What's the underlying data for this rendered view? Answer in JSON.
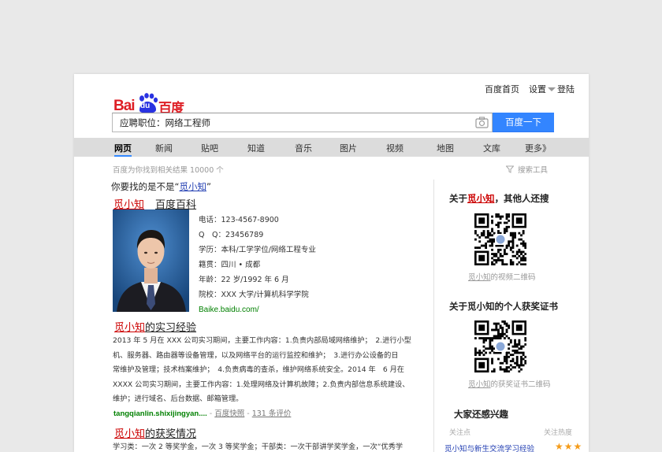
{
  "header": {
    "links": {
      "home": "百度首页",
      "settings": "设置",
      "login": "登陆"
    },
    "logo": {
      "bai": "Bai",
      "du": "du",
      "cn": "百度"
    }
  },
  "search": {
    "value": "应聘职位：网络工程师",
    "button": "百度一下",
    "camera_icon": "camera-icon"
  },
  "nav": {
    "items": [
      "网页",
      "新闻",
      "贴吧",
      "知道",
      "音乐",
      "图片",
      "视频",
      "地图",
      "文库",
      "更多》"
    ],
    "active": "网页"
  },
  "result_count": "百度为你找到相关结果 10000 个",
  "search_tools": "搜索工具",
  "suggestion": {
    "prefix": "你要找的是不是",
    "open_quote": "“",
    "term": "觅小知",
    "close_quote": "”"
  },
  "baike": {
    "name": "觅小知",
    "source": "百度百科",
    "info": [
      "电话：123-4567-8900",
      "Q　Q：23456789",
      "学历：本科/工学学位/网络工程专业",
      "籍贯：四川 • 成都",
      "年龄：22 岁/1992 年 6 月",
      "院校：XXX 大学/计算机科学学院"
    ],
    "url": "Baike.baidu.com/"
  },
  "internship": {
    "name": "觅小知",
    "title_suffix": "的实习经验",
    "lines": [
      "2013 年 5 月在 XXX 公司实习期间，主要工作内容：1.负责内部局域网络维护；　2.进行小型",
      "机、服务器、路由器等设备管理，以及网络平台的运行监控和维护；　3.进行办公设备的日",
      "常维护及管理；技术档案维护；　4.负责病毒的查杀，维护网络系统安全。2014 年　6 月在",
      "XXXX 公司实习期间，主要工作内容：1.处理网络及计算机故障；2.负责内部信息系统建设、",
      "维护；进行域名、后台数据、邮箱管理。"
    ],
    "source": "tangqianlin.shixijingyan....",
    "sep": " - ",
    "snapshot": "百度快照",
    "sep2": " - ",
    "reviews": "131 条评价"
  },
  "awards": {
    "name": "觅小知",
    "title_suffix": "的获奖情况",
    "line": "学习类：一次 2 等奖学金，一次 3 等奖学金；干部类：一次干部讲学奖学金，一次“优秀学"
  },
  "sidebar": {
    "others": {
      "prefix": "关于",
      "name": "觅小知",
      "suffix": "，其他人还搜"
    },
    "qr1_caption": {
      "name": "觅小知",
      "suffix": "的视频二维码"
    },
    "certificates_title": "关于觅小知的个人获奖证书",
    "qr2_caption": {
      "name": "觅小知",
      "suffix": "的获奖证书二维码"
    },
    "interest_title": "大家还感兴趣",
    "interest_head": {
      "left": "关注点",
      "right": "关注热度"
    },
    "interest_row": "觅小知与新生交流学习经验",
    "stars": "★★★"
  },
  "colors": {
    "brand_red": "#de1f26",
    "brand_blue": "#3385ff",
    "link": "#2440b3",
    "url_green": "#008000"
  }
}
